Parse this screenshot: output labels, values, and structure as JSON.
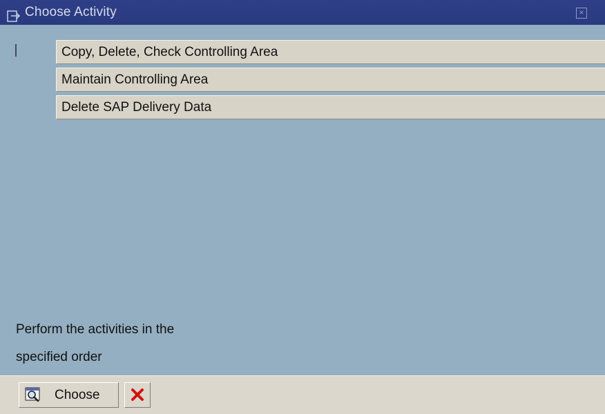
{
  "window": {
    "title": "Choose Activity",
    "title_icon": "dialog-arrow-icon",
    "close_icon": "close-icon"
  },
  "activities": [
    {
      "label": "Copy, Delete, Check Controlling Area"
    },
    {
      "label": "Maintain Controlling Area"
    },
    {
      "label": "Delete SAP Delivery Data"
    }
  ],
  "hint": {
    "line1": "Perform the activities in the",
    "line2": "specified order"
  },
  "footer": {
    "choose_label": "Choose",
    "choose_icon": "choose-magnifier-icon",
    "cancel_icon": "cancel-x-icon"
  },
  "colors": {
    "background": "#94afc1",
    "titlebar": "#2f3f87",
    "item": "#d8d3c7",
    "footer": "#dcd7cc",
    "cancel": "#d11111"
  }
}
